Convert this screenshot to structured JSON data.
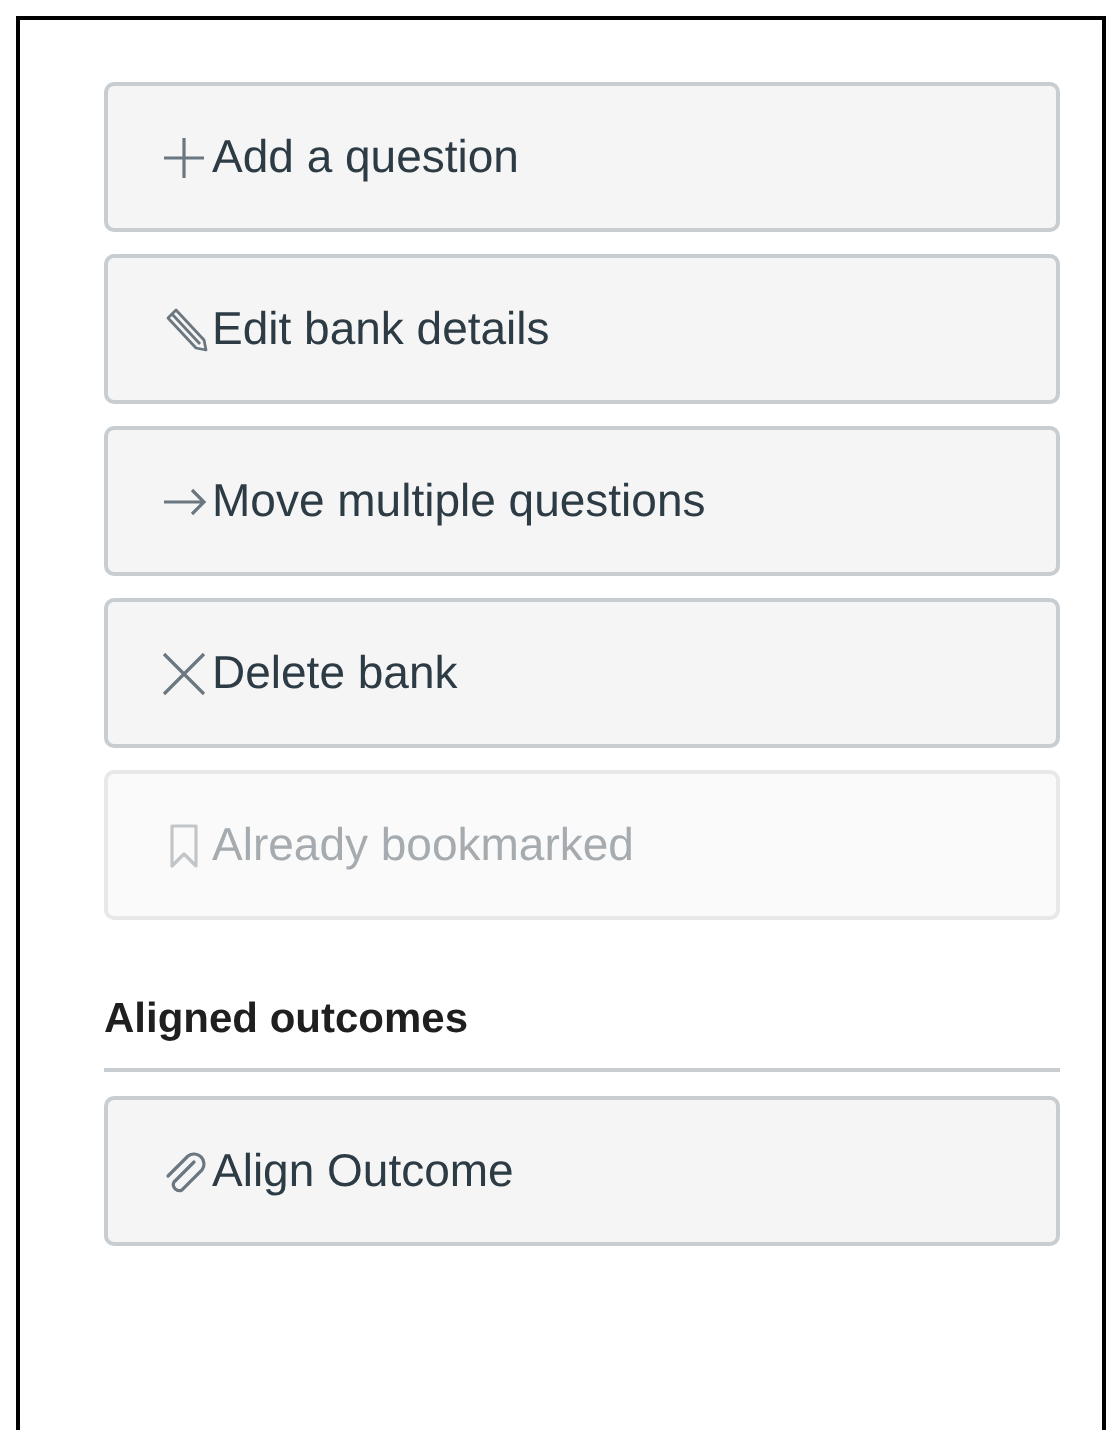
{
  "actions": [
    {
      "kind": "plus",
      "label": "Add a question",
      "disabled": false
    },
    {
      "kind": "pencil",
      "label": "Edit bank details",
      "disabled": false
    },
    {
      "kind": "arrow",
      "label": "Move multiple questions",
      "disabled": false
    },
    {
      "kind": "cross",
      "label": "Delete bank",
      "disabled": false
    },
    {
      "kind": "bookmark",
      "label": "Already bookmarked",
      "disabled": true
    }
  ],
  "outcomes": {
    "heading": "Aligned outcomes",
    "actions": [
      {
        "kind": "paperclip",
        "label": "Align Outcome",
        "disabled": false
      }
    ]
  }
}
